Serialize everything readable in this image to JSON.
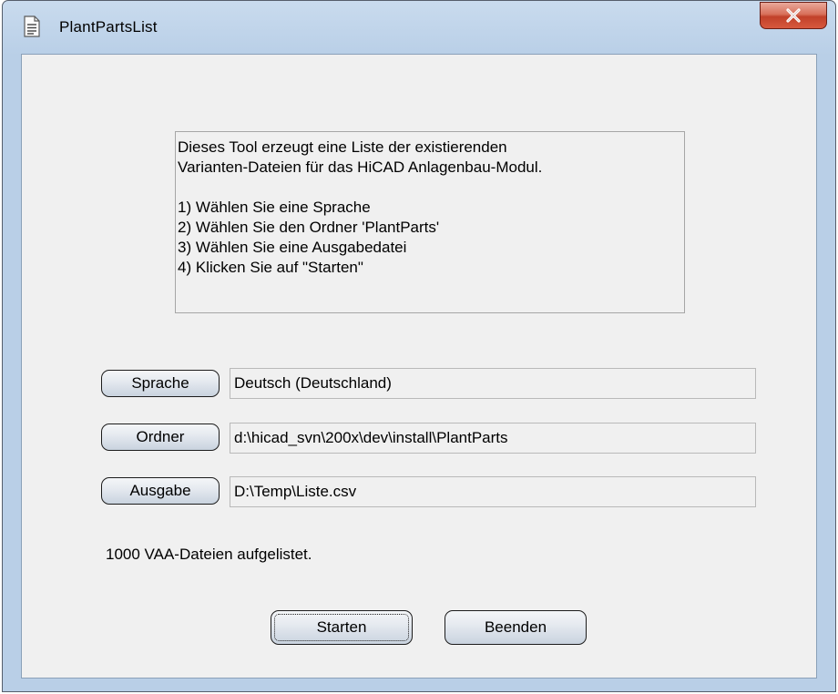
{
  "window": {
    "title": "PlantPartsList",
    "close_label": "X"
  },
  "info": {
    "lines": [
      "Dieses Tool erzeugt eine Liste der existierenden",
      "Varianten-Dateien für das HiCAD Anlagenbau-Modul.",
      "",
      "1) Wählen Sie eine Sprache",
      "2) Wählen Sie den Ordner 'PlantParts'",
      "3) Wählen Sie eine Ausgabedatei",
      "4) Klicken Sie auf \"Starten\""
    ]
  },
  "fields": {
    "sprache_button": "Sprache",
    "sprache_value": "Deutsch (Deutschland)",
    "ordner_button": "Ordner",
    "ordner_value": "d:\\hicad_svn\\200x\\dev\\install\\PlantParts",
    "ausgabe_button": "Ausgabe",
    "ausgabe_value": "D:\\Temp\\Liste.csv"
  },
  "status": {
    "text": "1000 VAA-Dateien aufgelistet."
  },
  "actions": {
    "start_label": "Starten",
    "exit_label": "Beenden"
  },
  "colors": {
    "frame": "#b9cfe7",
    "client_bg": "#f0f0f0",
    "close_button": "#c1412a"
  },
  "icons": {
    "title_icon": "document-icon",
    "close_icon": "close-icon"
  }
}
